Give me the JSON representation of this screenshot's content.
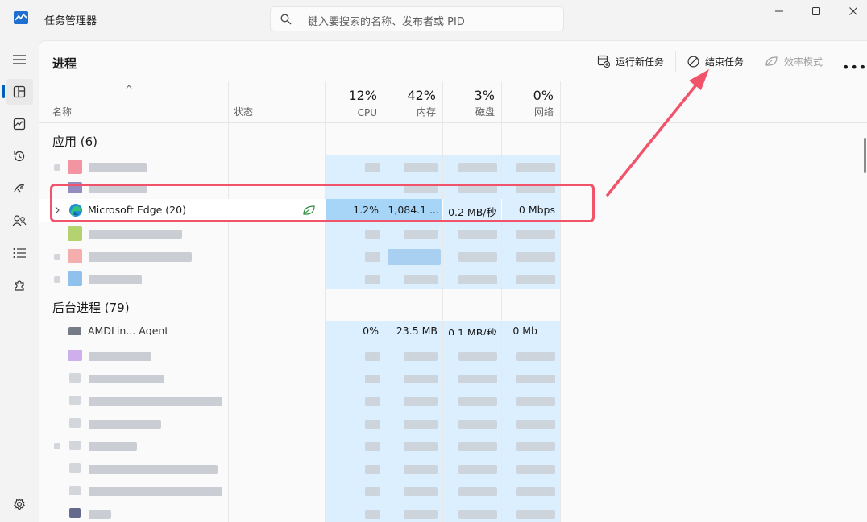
{
  "app": {
    "title": "任务管理器"
  },
  "search": {
    "placeholder": "键入要搜索的名称、发布者或 PID"
  },
  "page": {
    "title": "进程"
  },
  "toolbar": {
    "run_new_task": "运行新任务",
    "end_task": "结束任务",
    "efficiency_mode": "效率模式"
  },
  "columns": {
    "name": "名称",
    "status": "状态",
    "cpu": {
      "percent": "12%",
      "label": "CPU"
    },
    "memory": {
      "percent": "42%",
      "label": "内存"
    },
    "disk": {
      "percent": "3%",
      "label": "磁盘"
    },
    "network": {
      "percent": "0%",
      "label": "网络"
    }
  },
  "groups": {
    "apps": "应用 (6)",
    "background": "后台进程 (79)"
  },
  "highlighted_row": {
    "name": "Microsoft Edge (20)",
    "cpu": "1.2%",
    "memory": "1,084.1 ...",
    "disk": "0.2 MB/秒",
    "network": "0 Mbps"
  },
  "partial_row": {
    "name_fragment": "AMDLin... Agent",
    "cpu": "0%",
    "memory": "23.5 MB",
    "disk": "0.1 MB/秒",
    "network": "0 Mb"
  },
  "colors": {
    "accent": "#005fb8",
    "annotation": "#f0536a",
    "column_tint": "#dcefff"
  }
}
